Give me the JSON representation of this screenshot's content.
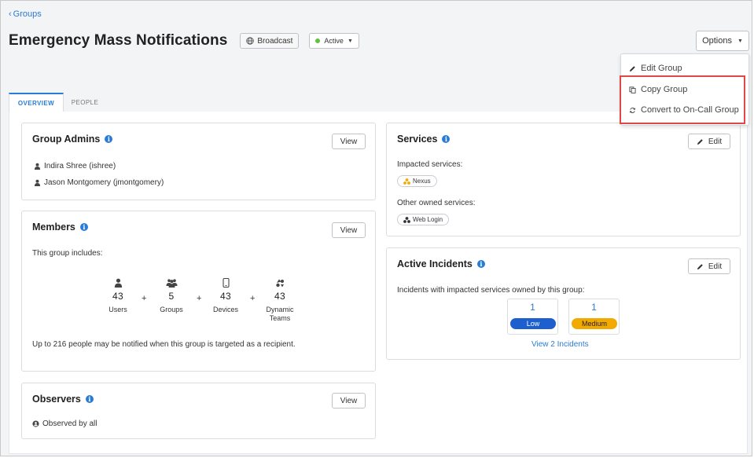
{
  "breadcrumb": {
    "back_label": "Groups"
  },
  "header": {
    "title": "Emergency Mass Notifications",
    "type_badge": "Broadcast",
    "status_label": "Active",
    "status_color": "#5cc33b",
    "options_label": "Options"
  },
  "options_menu": {
    "items": [
      {
        "label": "Edit Group",
        "icon": "pencil-icon"
      },
      {
        "label": "Copy Group",
        "icon": "copy-icon"
      },
      {
        "label": "Convert to On-Call Group",
        "icon": "convert-icon"
      }
    ]
  },
  "tabs": [
    {
      "label": "OVERVIEW",
      "active": true
    },
    {
      "label": "PEOPLE",
      "active": false
    }
  ],
  "group_admins": {
    "title": "Group Admins",
    "view_label": "View",
    "admins": [
      "Indira Shree (ishree)",
      "Jason Montgomery (jmontgomery)"
    ]
  },
  "members": {
    "title": "Members",
    "view_label": "View",
    "intro": "This group includes:",
    "stats": [
      {
        "count": "43",
        "label": "Users",
        "icon": "user-icon"
      },
      {
        "count": "5",
        "label": "Groups",
        "icon": "groups-icon"
      },
      {
        "count": "43",
        "label": "Devices",
        "icon": "device-icon"
      },
      {
        "count": "43",
        "label": "Dynamic Teams",
        "icon": "dynamic-teams-icon"
      }
    ],
    "plus": "+",
    "footer": "Up to 216 people may be notified when this group is targeted as a recipient."
  },
  "observers": {
    "title": "Observers",
    "view_label": "View",
    "text": "Observed by all"
  },
  "services": {
    "title": "Services",
    "edit_label": "Edit",
    "impacted_label": "Impacted services:",
    "impacted": [
      {
        "name": "Nexus",
        "color": "#f2a900"
      }
    ],
    "owned_label": "Other owned services:",
    "owned": [
      {
        "name": "Web Login",
        "color": "#333333"
      }
    ]
  },
  "active_incidents": {
    "title": "Active Incidents",
    "edit_label": "Edit",
    "description": "Incidents with impacted services owned by this group:",
    "severities": [
      {
        "count": "1",
        "label": "Low",
        "color": "#1e5fcf"
      },
      {
        "count": "1",
        "label": "Medium",
        "color": "#f2a900"
      }
    ],
    "view_link": "View 2 Incidents"
  },
  "colors": {
    "accent": "#2a7bd6",
    "highlight": "#e04848"
  }
}
